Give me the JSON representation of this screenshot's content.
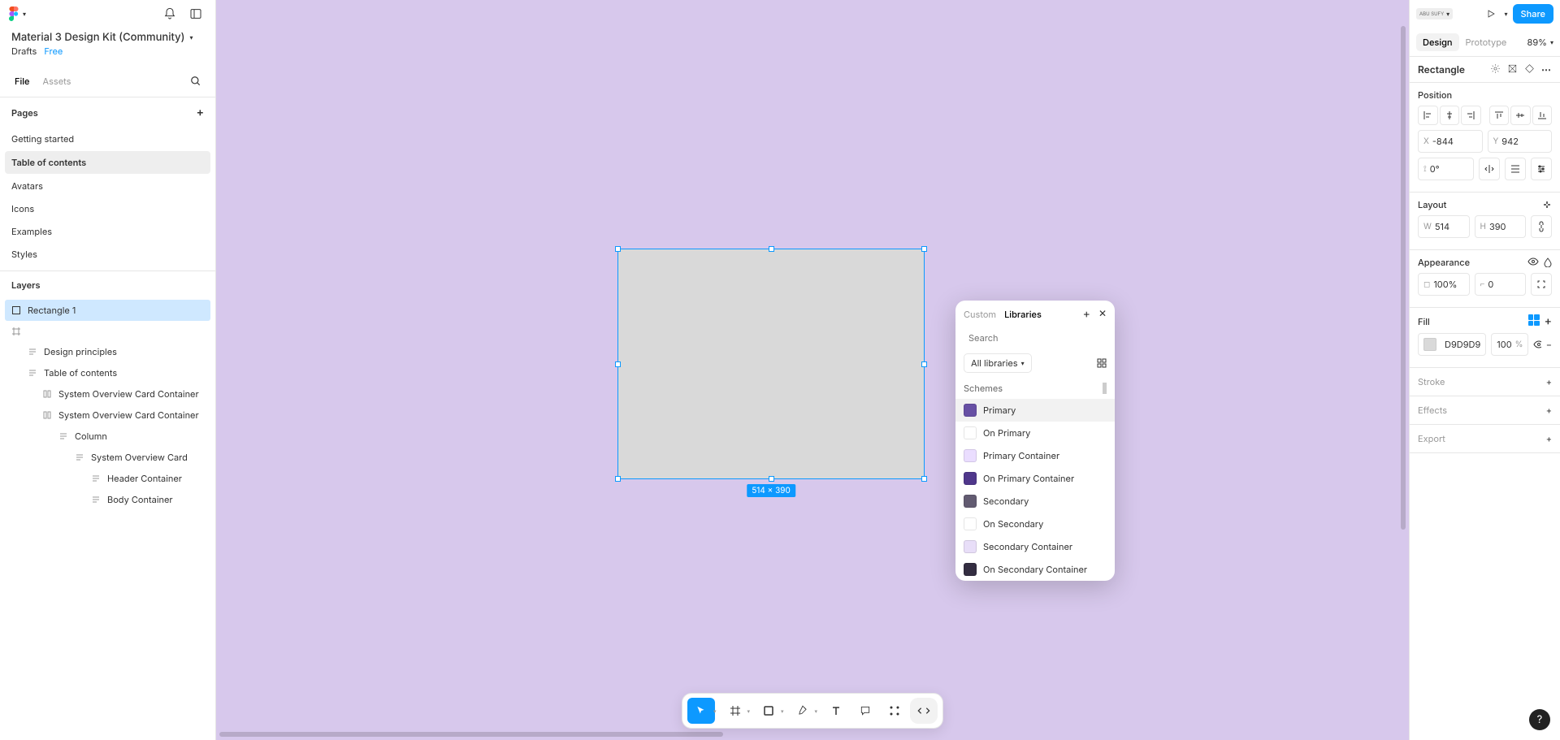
{
  "header": {
    "file_title": "Material 3 Design Kit (Community)",
    "drafts_label": "Drafts",
    "plan_label": "Free"
  },
  "left_tabs": {
    "file": "File",
    "assets": "Assets"
  },
  "pages": {
    "header": "Pages",
    "items": [
      "Getting started",
      "Table of contents",
      "Avatars",
      "Icons",
      "Examples",
      "Styles"
    ],
    "active_index": 1
  },
  "layers": {
    "header": "Layers",
    "items": [
      {
        "label": "Rectangle 1",
        "icon": "rect",
        "indent": 0,
        "selected": true
      },
      {
        "label": "",
        "icon": "frame",
        "indent": 0
      },
      {
        "label": "Design principles",
        "icon": "text",
        "indent": 1
      },
      {
        "label": "Table of contents",
        "icon": "text",
        "indent": 1
      },
      {
        "label": "System Overview Card Container",
        "icon": "autolayout",
        "indent": 2
      },
      {
        "label": "System Overview Card Container",
        "icon": "autolayout",
        "indent": 2
      },
      {
        "label": "Column",
        "icon": "text",
        "indent": 3
      },
      {
        "label": "System Overview Card",
        "icon": "text",
        "indent": 4
      },
      {
        "label": "Header Container",
        "icon": "text",
        "indent": 5
      },
      {
        "label": "Body Container",
        "icon": "text",
        "indent": 5
      }
    ]
  },
  "canvas": {
    "selection_dims": "514 × 390"
  },
  "right_top": {
    "share": "Share"
  },
  "right_tabs": {
    "design": "Design",
    "prototype": "Prototype",
    "zoom": "89%"
  },
  "inspector": {
    "selection_name": "Rectangle",
    "position": {
      "title": "Position",
      "x": "-844",
      "y": "942",
      "rotation": "0°"
    },
    "layout": {
      "title": "Layout",
      "w": "514",
      "h": "390"
    },
    "appearance": {
      "title": "Appearance",
      "opacity": "100%",
      "radius": "0"
    },
    "fill": {
      "title": "Fill",
      "hex": "D9D9D9",
      "opacity": "100",
      "unit": "%"
    },
    "stroke": "Stroke",
    "effects": "Effects",
    "export": "Export"
  },
  "libraries": {
    "tab_custom": "Custom",
    "tab_libraries": "Libraries",
    "search_placeholder": "Search",
    "filter_label": "All libraries",
    "section": "Schemes",
    "schemes": [
      {
        "name": "Primary",
        "color": "#6750a4"
      },
      {
        "name": "On Primary",
        "color": "#ffffff"
      },
      {
        "name": "Primary Container",
        "color": "#eaddff"
      },
      {
        "name": "On Primary Container",
        "color": "#4f378b"
      },
      {
        "name": "Secondary",
        "color": "#625b71"
      },
      {
        "name": "On Secondary",
        "color": "#ffffff"
      },
      {
        "name": "Secondary Container",
        "color": "#e8def8"
      },
      {
        "name": "On Secondary Container",
        "color": "#332d41"
      }
    ]
  }
}
